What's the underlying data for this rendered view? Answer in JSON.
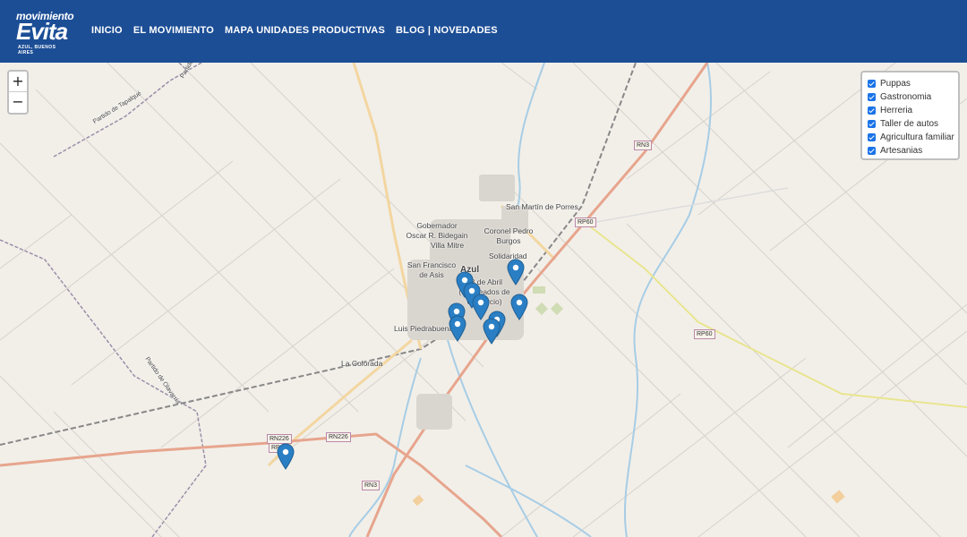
{
  "header": {
    "logo": {
      "line1": "movimiento",
      "line2": "Evita",
      "line3": "AZUL, BUENOS AIRES"
    },
    "nav": [
      "INICIO",
      "EL MOVIMIENTO",
      "MAPA UNIDADES PRODUCTIVAS",
      "BLOG | NOVEDADES"
    ]
  },
  "map": {
    "zoom_in": "+",
    "zoom_out": "−",
    "layers": [
      {
        "label": "Puppas",
        "checked": true
      },
      {
        "label": "Gastronomia",
        "checked": true
      },
      {
        "label": "Herreria",
        "checked": true
      },
      {
        "label": "Taller de autos",
        "checked": true
      },
      {
        "label": "Agricultura familiar",
        "checked": true
      },
      {
        "label": "Artesanias",
        "checked": true
      }
    ],
    "place_labels": {
      "san_martin": "San Martín de Porres",
      "gobernador": "Gobernador Oscar R. Bidegain",
      "coronel": "Coronel Pedro Burgos",
      "villa_mitre": "Villa Mitre",
      "solidaridad": "Solidaridad",
      "san_francisco": "San Francisco de Asis",
      "azul": "Azul",
      "abril": "18 de Abril (Empleados de Comercio)",
      "luis": "Luis Piedrabuena",
      "colorada": "La Colorada",
      "tapalque": "Partido de Tapalqué",
      "olavarria": "Partido de Olavarría",
      "partido_top": "Partido"
    },
    "road_labels": {
      "rn3_top": "RN3",
      "rp60_top": "RP60",
      "rp60_right": "RP60",
      "rn226_a": "RN226",
      "rn226_b": "RN226",
      "rn226_c": "RP",
      "rn3_bottom": "RN3"
    },
    "marker_color": "#2a7fc4",
    "marker_count": 11
  }
}
